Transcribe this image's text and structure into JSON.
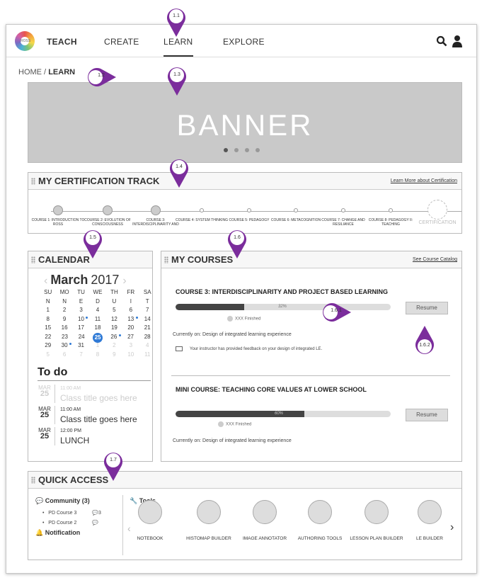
{
  "nav": {
    "teach": "TEACH",
    "create": "CREATE",
    "learn": "LEARN",
    "explore": "EXPLORE"
  },
  "breadcrumb": {
    "home": "HOME /",
    "current": "LEARN"
  },
  "banner": {
    "text": "BANNER",
    "slides": 4,
    "active_slide": 1
  },
  "certification": {
    "title": "MY CERTIFICATION TRACK",
    "link": "Learn More about Certification",
    "steps": [
      {
        "label": "COURSE 1: INTRODUCTION TO ROSS",
        "state": "done"
      },
      {
        "label": "COURSE 2: EVOLUTION OF CONSCIOUSNESS",
        "state": "done"
      },
      {
        "label": "COURSE 3: INTERDISCIPLINARITY AND",
        "state": "done"
      },
      {
        "label": "COURSE 4: SYSTEM THINKING",
        "state": "todo"
      },
      {
        "label": "COURSE 5: PEDAGOGY",
        "state": "todo"
      },
      {
        "label": "COURSE 6: METACOGNITION",
        "state": "todo"
      },
      {
        "label": "COURSE 7: CHANGE AND RESILIANCE",
        "state": "todo"
      },
      {
        "label": "COURSE 8: PEDAGOGY II: TEACHING",
        "state": "todo"
      },
      {
        "label": "CERTIFICATION",
        "state": "final"
      }
    ]
  },
  "calendar": {
    "title": "CALENDAR",
    "month": "March",
    "year": "2017",
    "days": [
      "SU",
      "MO",
      "TU",
      "WE",
      "TH",
      "FR",
      "SA"
    ],
    "days2": [
      "N",
      "N",
      "E",
      "D",
      "U",
      "I",
      "T"
    ],
    "weeks": [
      [
        "1",
        "2",
        "3",
        "4",
        "5",
        "6",
        "7"
      ],
      [
        "8",
        "9",
        "10",
        "11",
        "12",
        "13",
        "14"
      ],
      [
        "15",
        "16",
        "17",
        "18",
        "19",
        "20",
        "21"
      ],
      [
        "22",
        "23",
        "24",
        "25",
        "26",
        "27",
        "28"
      ],
      [
        "29",
        "30",
        "31",
        "1",
        "2",
        "3",
        "4"
      ],
      [
        "5",
        "6",
        "7",
        "8",
        "9",
        "10",
        "11"
      ]
    ],
    "selected": "25"
  },
  "todo": {
    "title": "To do",
    "items": [
      {
        "month": "MAR",
        "day": "25",
        "time": "11:00 AM",
        "text": "Class title goes here",
        "past": true
      },
      {
        "month": "MAR",
        "day": "25",
        "time": "11:00 AM",
        "text": "Class title goes here",
        "past": false
      },
      {
        "month": "MAR",
        "day": "25",
        "time": "12:00 PM",
        "text": "LUNCH",
        "past": false
      }
    ]
  },
  "courses": {
    "title": "MY COURSES",
    "link": "See Course Catalog",
    "items": [
      {
        "title": "COURSE 3: INTERDISCIPLINARITY AND PROJECT BASED LEARNING",
        "progress": 32,
        "progress_label": "32%",
        "finished": "XXX Finished",
        "current": "Currently on: Design of integrated learning experience",
        "feedback": "Your instructor has provided feedback on your design of integrated LE.",
        "button": "Resume"
      },
      {
        "title": "MINI COURSE: TEACHING CORE VALUES AT LOWER SCHOOL",
        "progress": 60,
        "progress_label": "60%",
        "finished": "XXX Finished",
        "current": "Currently on: Design of integrated learning experience",
        "button": "Resume"
      }
    ]
  },
  "quick_access": {
    "title": "QUICK ACCESS",
    "community": {
      "label": "Community (3)",
      "items": [
        {
          "name": "PD Course 3",
          "count": "3"
        },
        {
          "name": "PD Course 2",
          "count": ""
        }
      ]
    },
    "notification": "Notification",
    "tools_label": "Tools",
    "tools": [
      "NOTEBOOK",
      "HISTOMAP BUILDER",
      "IMAGE ANNOTATOR",
      "AUTHORING TOOLS",
      "LESSON PLAN BUILDER",
      "LE BUILDER"
    ]
  },
  "annotations": [
    "1.1",
    "1.2",
    "1.3",
    "1.4",
    "1.5",
    "1.6",
    "1.6.1",
    "1.6.2",
    "1.7"
  ],
  "colors": {
    "accent": "#7b2d9c",
    "selected_day": "#2f7ad6"
  }
}
